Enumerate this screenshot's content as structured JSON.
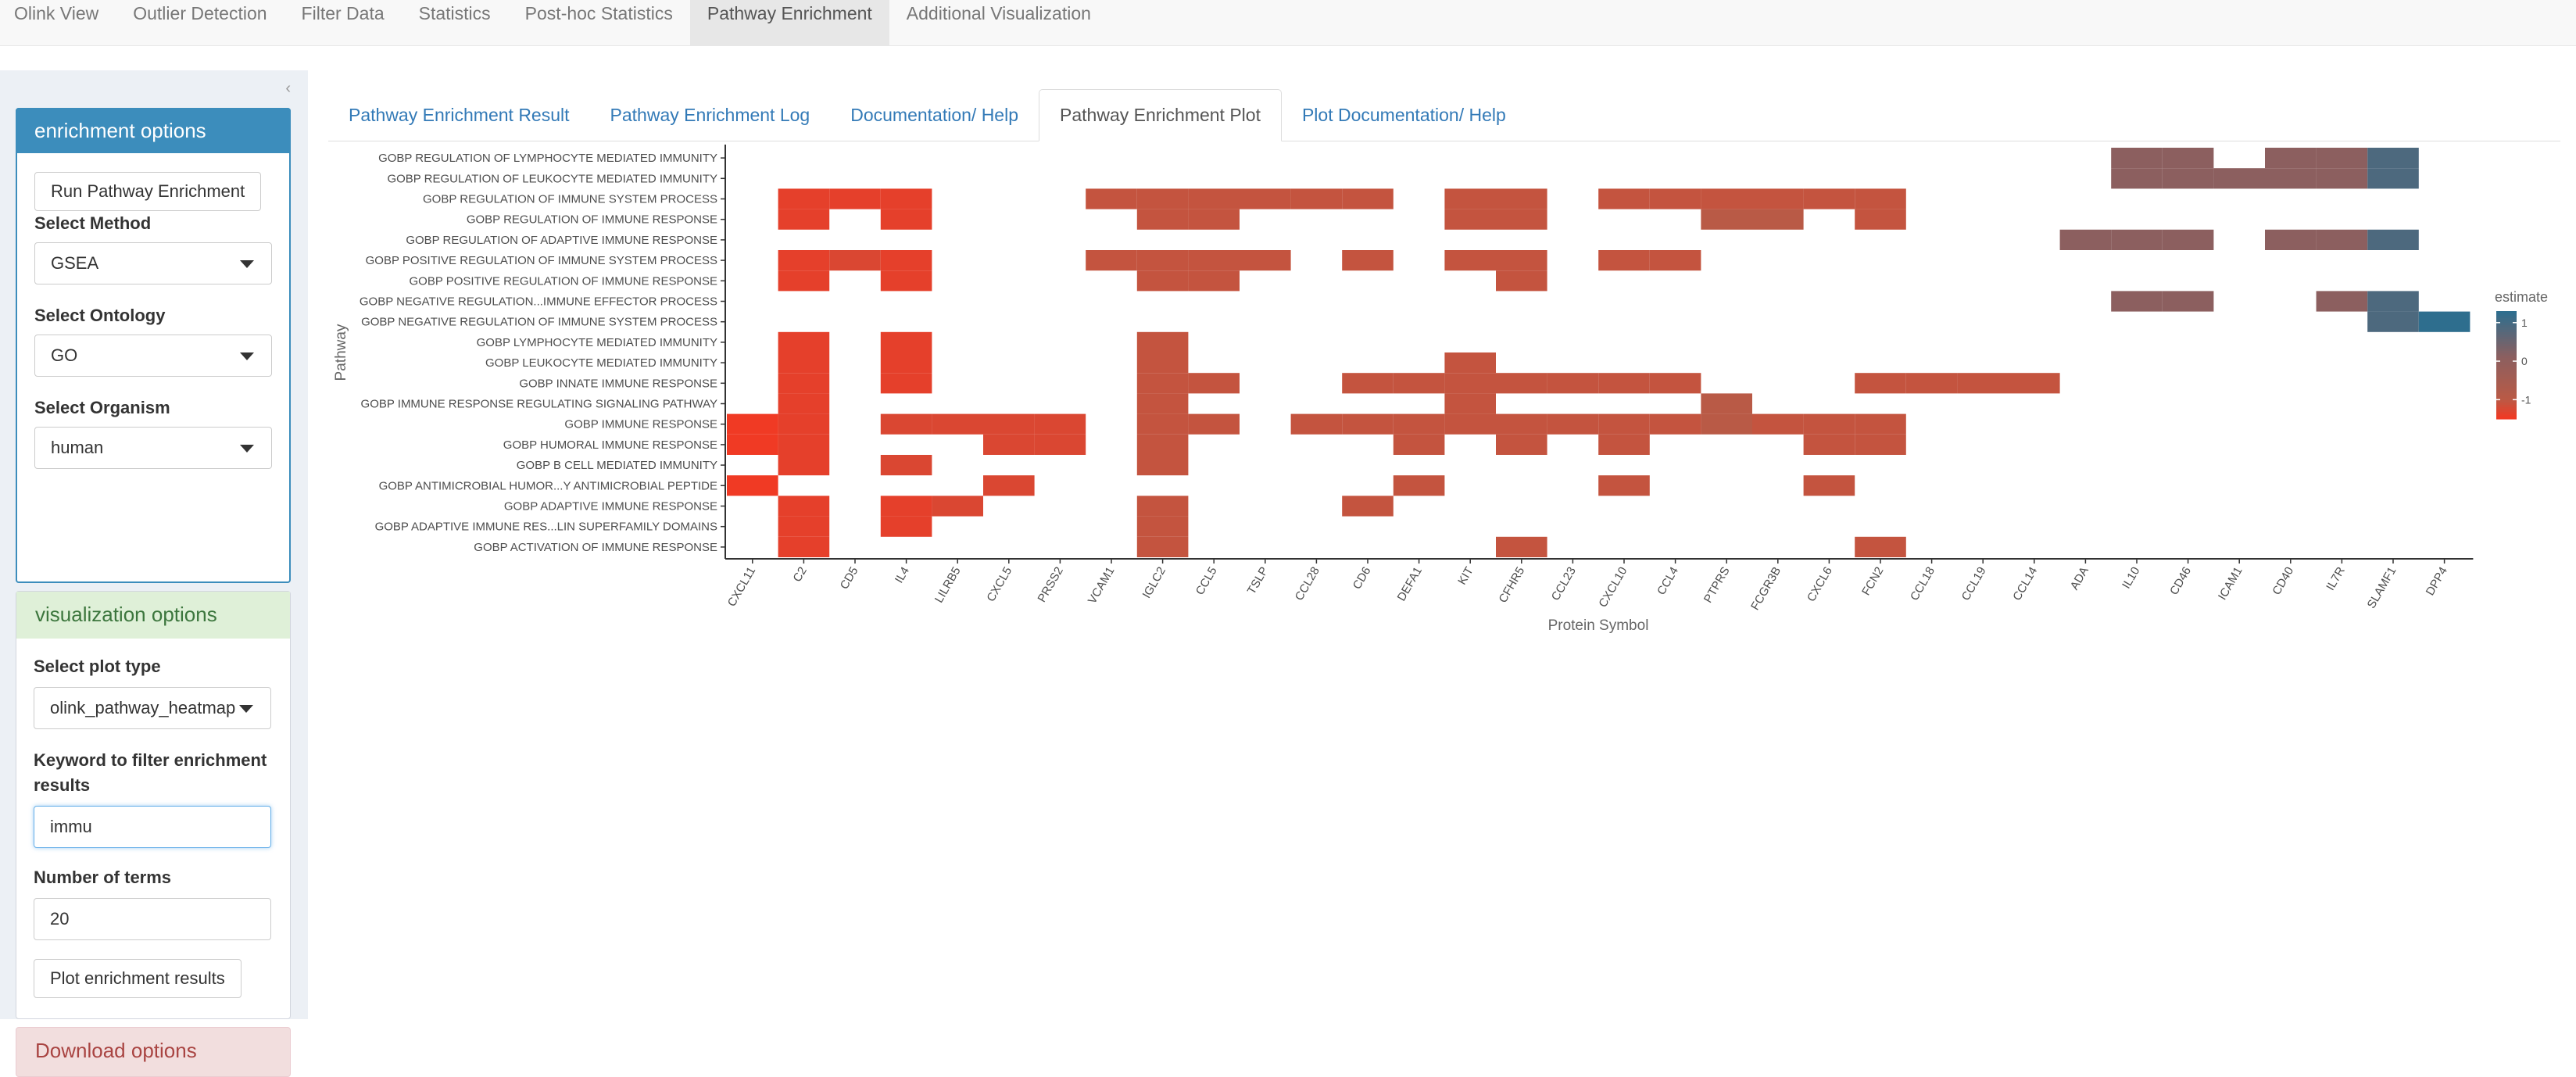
{
  "navbar": {
    "tabs": [
      {
        "label": "Olink View",
        "active": false
      },
      {
        "label": "Outlier Detection",
        "active": false
      },
      {
        "label": "Filter Data",
        "active": false
      },
      {
        "label": "Statistics",
        "active": false
      },
      {
        "label": "Post-hoc Statistics",
        "active": false
      },
      {
        "label": "Pathway Enrichment",
        "active": true
      },
      {
        "label": "Additional Visualization",
        "active": false
      }
    ]
  },
  "sidebar": {
    "collapse_icon": "chevron-left-icon",
    "enrichment": {
      "header": "enrichment options",
      "run_button": "Run Pathway Enrichment",
      "method_label": "Select Method",
      "method_value": "GSEA",
      "ontology_label": "Select Ontology",
      "ontology_value": "GO",
      "organism_label": "Select Organism",
      "organism_value": "human"
    },
    "visualization": {
      "header": "visualization options",
      "plot_type_label": "Select plot type",
      "plot_type_value": "olink_pathway_heatmap",
      "keyword_label": "Keyword to filter enrichment results",
      "keyword_value": "immu",
      "terms_label": "Number of terms",
      "terms_value": "20",
      "plot_button": "Plot enrichment results"
    },
    "download": {
      "header": "Download options"
    }
  },
  "main": {
    "tabs": [
      {
        "label": "Pathway Enrichment Result",
        "active": false
      },
      {
        "label": "Pathway Enrichment Log",
        "active": false
      },
      {
        "label": "Documentation/ Help",
        "active": false
      },
      {
        "label": "Pathway Enrichment Plot",
        "active": true
      },
      {
        "label": "Plot Documentation/ Help",
        "active": false
      }
    ]
  },
  "colors": {
    "primary": "#3c8dbc",
    "success_bg": "#dff0d8",
    "danger_bg": "#f2dede",
    "high": "#2e6e8e",
    "low": "#f03a24"
  },
  "chart_data": {
    "type": "heatmap",
    "xlabel": "Protein Symbol",
    "ylabel": "Pathway",
    "legend_title": "estimate",
    "legend_ticks": [
      1,
      0,
      -1
    ],
    "legend_placement": "right",
    "columns": [
      "CXCL11",
      "C2",
      "CD5",
      "IL4",
      "LILRB5",
      "CXCL5",
      "PRSS2",
      "VCAM1",
      "IGLC2",
      "CCL5",
      "TSLP",
      "CCL28",
      "CD6",
      "DEFA1",
      "KIT",
      "CFHR5",
      "CCL23",
      "CXCL10",
      "CCL4",
      "PTPRS",
      "FCGR3B",
      "CXCL6",
      "FCN2",
      "CCL18",
      "CCL19",
      "CCL14",
      "ADA",
      "IL10",
      "CD46",
      "ICAM1",
      "CD40",
      "IL7R",
      "SLAMF1",
      "DPP4"
    ],
    "rows": [
      {
        "pathway": "GOBP REGULATION OF LYMPHOCYTE MEDIATED IMMUNITY",
        "cells": {
          "IL10": 0.1,
          "CD46": 0.1,
          "CD40": 0.1,
          "IL7R": 0.1,
          "SLAMF1": 0.9
        }
      },
      {
        "pathway": "GOBP REGULATION OF LEUKOCYTE MEDIATED IMMUNITY",
        "cells": {
          "IL10": 0.1,
          "CD46": 0.1,
          "ICAM1": 0.1,
          "CD40": 0.1,
          "IL7R": 0.1,
          "SLAMF1": 0.9
        }
      },
      {
        "pathway": "GOBP REGULATION OF IMMUNE SYSTEM PROCESS",
        "cells": {
          "C2": -1.4,
          "CD5": -1.4,
          "IL4": -1.4,
          "VCAM1": -1.1,
          "IGLC2": -1.1,
          "CCL5": -1.1,
          "TSLP": -1.1,
          "CCL28": -1.1,
          "CD6": -1.1,
          "KIT": -1.1,
          "CFHR5": -1.1,
          "CXCL10": -1.1,
          "CCL4": -1.1,
          "PTPRS": -1.1,
          "FCGR3B": -1.1,
          "CXCL6": -1.1,
          "FCN2": -1.1
        }
      },
      {
        "pathway": "GOBP REGULATION OF IMMUNE RESPONSE",
        "cells": {
          "C2": -1.4,
          "IL4": -1.4,
          "IGLC2": -1.1,
          "CCL5": -1.1,
          "KIT": -1.1,
          "CFHR5": -1.1,
          "PTPRS": -1.0,
          "FCGR3B": -1.0,
          "FCN2": -1.1
        }
      },
      {
        "pathway": "GOBP REGULATION OF ADAPTIVE IMMUNE RESPONSE",
        "cells": {
          "ADA": 0.1,
          "IL10": 0.1,
          "CD46": 0.1,
          "CD40": 0.1,
          "IL7R": 0.1,
          "SLAMF1": 0.9
        }
      },
      {
        "pathway": "GOBP POSITIVE REGULATION OF IMMUNE SYSTEM PROCESS",
        "cells": {
          "C2": -1.4,
          "CD5": -1.3,
          "IL4": -1.4,
          "VCAM1": -1.1,
          "IGLC2": -1.1,
          "CCL5": -1.1,
          "TSLP": -1.1,
          "CD6": -1.1,
          "KIT": -1.1,
          "CFHR5": -1.1,
          "CXCL10": -1.1,
          "CCL4": -1.1
        }
      },
      {
        "pathway": "GOBP POSITIVE REGULATION OF IMMUNE RESPONSE",
        "cells": {
          "C2": -1.4,
          "IL4": -1.4,
          "IGLC2": -1.1,
          "CCL5": -1.1,
          "CFHR5": -1.1
        }
      },
      {
        "pathway": "GOBP NEGATIVE REGULATION...IMMUNE EFFECTOR PROCESS",
        "cells": {
          "IL10": 0.1,
          "CD46": 0.1,
          "IL7R": 0.1,
          "SLAMF1": 0.9
        }
      },
      {
        "pathway": "GOBP NEGATIVE REGULATION OF IMMUNE SYSTEM PROCESS",
        "cells": {
          "SLAMF1": 0.9,
          "DPP4": 1.3
        }
      },
      {
        "pathway": "GOBP LYMPHOCYTE MEDIATED IMMUNITY",
        "cells": {
          "C2": -1.4,
          "IL4": -1.4,
          "IGLC2": -1.1
        }
      },
      {
        "pathway": "GOBP LEUKOCYTE MEDIATED IMMUNITY",
        "cells": {
          "C2": -1.4,
          "IL4": -1.4,
          "IGLC2": -1.1,
          "KIT": -1.1
        }
      },
      {
        "pathway": "GOBP INNATE IMMUNE RESPONSE",
        "cells": {
          "C2": -1.4,
          "IL4": -1.4,
          "IGLC2": -1.1,
          "CCL5": -1.1,
          "CD6": -1.1,
          "DEFA1": -1.1,
          "KIT": -1.1,
          "CFHR5": -1.1,
          "CCL23": -1.1,
          "CXCL10": -1.1,
          "CCL4": -1.1,
          "FCN2": -1.1,
          "CCL18": -1.1,
          "CCL19": -1.1,
          "CCL14": -1.1
        }
      },
      {
        "pathway": "GOBP IMMUNE RESPONSE REGULATING SIGNALING PATHWAY",
        "cells": {
          "C2": -1.4,
          "IGLC2": -1.1,
          "KIT": -1.1,
          "PTPRS": -1.0
        }
      },
      {
        "pathway": "GOBP IMMUNE RESPONSE",
        "cells": {
          "CXCL11": -1.5,
          "C2": -1.4,
          "IL4": -1.3,
          "LILRB5": -1.3,
          "CXCL5": -1.3,
          "PRSS2": -1.3,
          "IGLC2": -1.1,
          "CCL5": -1.1,
          "CCL28": -1.1,
          "CD6": -1.1,
          "DEFA1": -1.1,
          "KIT": -1.1,
          "CFHR5": -1.1,
          "CCL23": -1.1,
          "CXCL10": -1.1,
          "CCL4": -1.1,
          "PTPRS": -1.0,
          "FCGR3B": -1.1,
          "CXCL6": -1.1,
          "FCN2": -1.1
        }
      },
      {
        "pathway": "GOBP HUMORAL IMMUNE RESPONSE",
        "cells": {
          "CXCL11": -1.5,
          "C2": -1.4,
          "CXCL5": -1.3,
          "PRSS2": -1.3,
          "IGLC2": -1.1,
          "DEFA1": -1.1,
          "CFHR5": -1.1,
          "CXCL10": -1.1,
          "CXCL6": -1.1,
          "FCN2": -1.1
        }
      },
      {
        "pathway": "GOBP B CELL MEDIATED IMMUNITY",
        "cells": {
          "C2": -1.4,
          "IL4": -1.3,
          "IGLC2": -1.1
        }
      },
      {
        "pathway": "GOBP ANTIMICROBIAL HUMOR...Y ANTIMICROBIAL PEPTIDE",
        "cells": {
          "CXCL11": -1.5,
          "CXCL5": -1.3,
          "DEFA1": -1.1,
          "CXCL10": -1.1,
          "CXCL6": -1.1
        }
      },
      {
        "pathway": "GOBP ADAPTIVE IMMUNE RESPONSE",
        "cells": {
          "C2": -1.4,
          "IL4": -1.4,
          "LILRB5": -1.3,
          "IGLC2": -1.1,
          "CD6": -1.1
        }
      },
      {
        "pathway": "GOBP ADAPTIVE IMMUNE RES...LIN SUPERFAMILY DOMAINS",
        "cells": {
          "C2": -1.4,
          "IL4": -1.4,
          "IGLC2": -1.1
        }
      },
      {
        "pathway": "GOBP ACTIVATION OF IMMUNE RESPONSE",
        "cells": {
          "C2": -1.4,
          "IGLC2": -1.1,
          "CFHR5": -1.1,
          "FCN2": -1.1
        }
      }
    ]
  }
}
